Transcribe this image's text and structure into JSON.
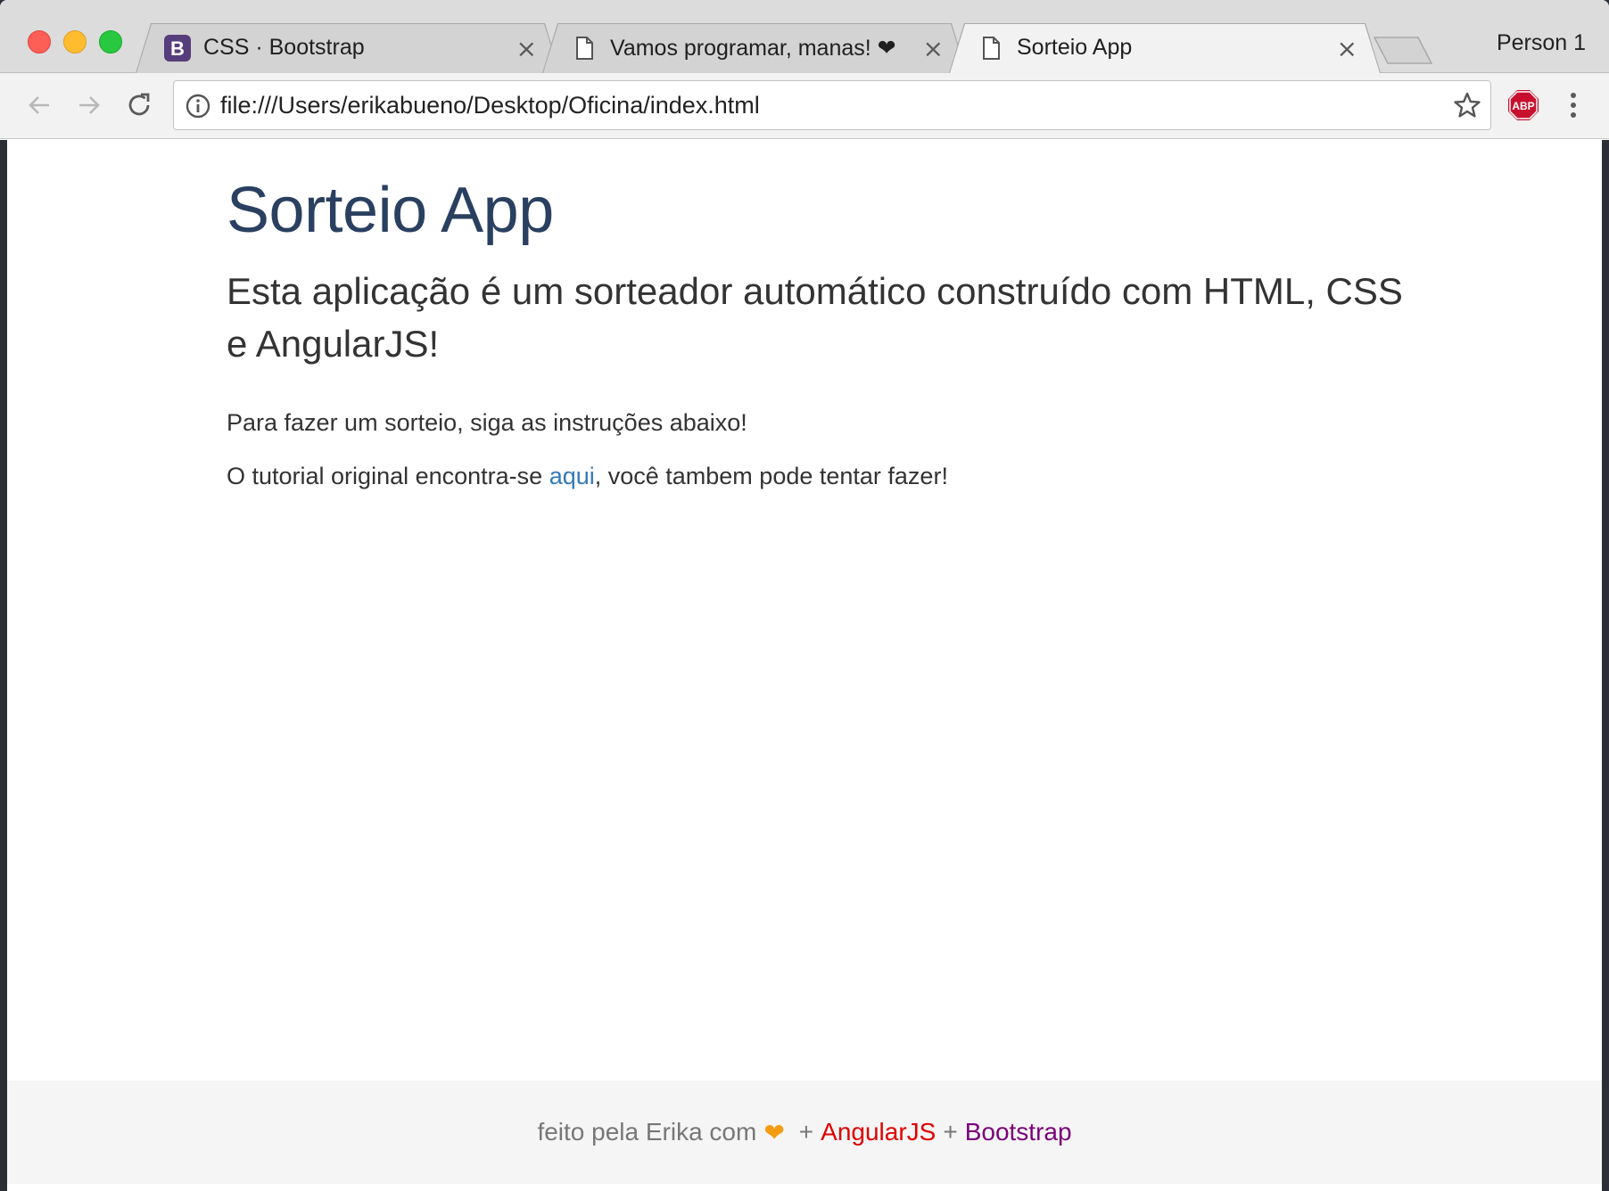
{
  "browser": {
    "tabs": [
      {
        "title": "CSS · Bootstrap",
        "favicon": "bootstrap-icon",
        "active": false
      },
      {
        "title": "Vamos programar, manas! ❤",
        "favicon": "page-icon",
        "active": false
      },
      {
        "title": "Sorteio App",
        "favicon": "page-icon",
        "active": true
      }
    ],
    "profile": "Person 1",
    "url": "file:///Users/erikabueno/Desktop/Oficina/index.html",
    "close_glyph": "×",
    "bootstrap_glyph": "B",
    "abp_label": "ABP"
  },
  "page": {
    "title": "Sorteio App",
    "lead": "Esta aplicação é um sorteador automático construído com HTML, CSS e AngularJS!",
    "para1": "Para fazer um sorteio, siga as instruções abaixo!",
    "para2_prefix": "O tutorial original encontra-se ",
    "para2_link": "aqui",
    "para2_suffix": ", você tambem pode tentar fazer!"
  },
  "footer": {
    "prefix": "feito pela Erika com",
    "heart": "❤",
    "plus": "+",
    "angular": "AngularJS",
    "bootstrap": "Bootstrap"
  },
  "colors": {
    "title": "#2a4060",
    "link": "#337ab7",
    "angular": "#e00000",
    "bootstrap": "#7a007a",
    "heart": "#f39c12"
  }
}
